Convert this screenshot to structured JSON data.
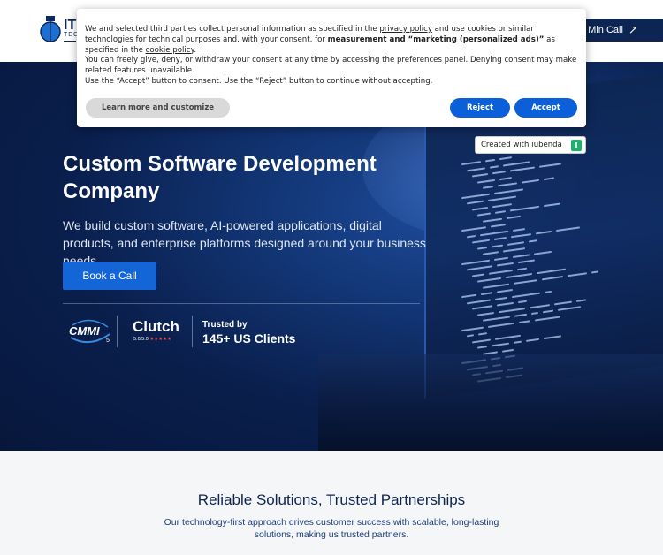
{
  "header": {
    "logo_text": "IT",
    "logo_sub": "TEC",
    "cta_label": "o Min Call",
    "cta_icon": "arrow-up-right-icon"
  },
  "hero": {
    "title": "Custom Software Development Company",
    "subtitle": "We build custom software, AI-powered applications, digital products, and enterprise platforms designed around your business needs.",
    "book_button": "Book a Call",
    "badges": {
      "cmmi_label": "CMMI",
      "cmmi_level": "5",
      "clutch_label": "Clutch",
      "clutch_rating": "5.0/5.0",
      "clutch_stars": "★★★★★",
      "trusted_label": "Trusted by",
      "trusted_value": "145+ US Clients"
    }
  },
  "section": {
    "title": "Reliable Solutions, Trusted Partnerships",
    "description": "Our technology-first approach drives customer success with scalable, long-lasting solutions, making us trusted partners."
  },
  "cookie_banner": {
    "p1_a": "We and selected third parties collect personal information as specified in the ",
    "privacy_link": "privacy policy",
    "p1_b": " and use cookies or similar technologies for technical purposes and, with your consent, for ",
    "p1_bold": "measurement and “marketing (personalized ads)”",
    "p1_c": " as specified in the ",
    "cookie_link": "cookie policy",
    "p1_d": ".",
    "p2": "You can freely give, deny, or withdraw your consent at any time by accessing the preferences panel. Denying consent may make related features unavailable.",
    "p3": "Use the “Accept” button to consent. Use the “Reject” button to continue without accepting.",
    "learn_more": "Learn more and customize",
    "reject": "Reject",
    "accept": "Accept"
  },
  "iubenda": {
    "prefix": "Created with ",
    "link": "iubenda"
  },
  "colors": {
    "navy": "#0c2552",
    "accent_blue": "#1466d6",
    "cookie_button_blue": "#0b5fd8"
  }
}
